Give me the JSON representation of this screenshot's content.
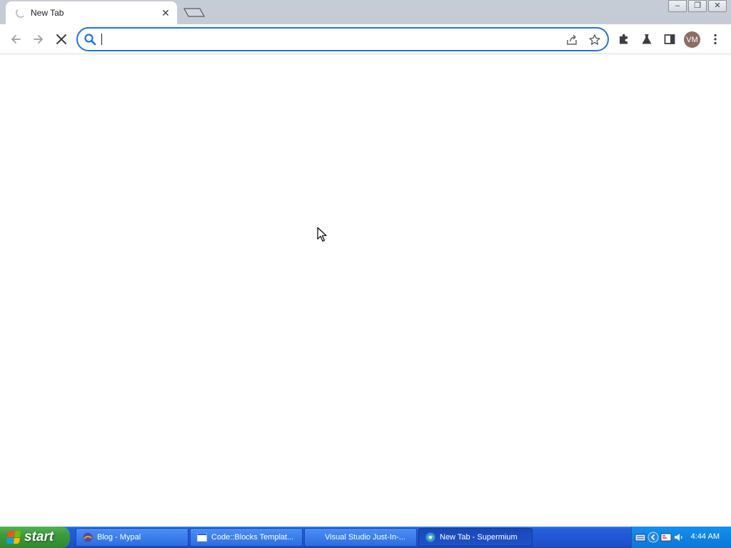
{
  "browser": {
    "tab": {
      "title": "New Tab",
      "close_glyph": "✕"
    },
    "window_controls": {
      "minimize": "–",
      "restore": "❐",
      "close": "✕"
    },
    "omnibox": {
      "value": "",
      "placeholder": ""
    },
    "profile_initials": "VM",
    "accent_color": "#1a73e8"
  },
  "taskbar": {
    "start_label": "start",
    "tasks": [
      {
        "label": "Blog - Mypal",
        "icon": "mypal-icon"
      },
      {
        "label": "Code::Blocks Templat...",
        "icon": "window-icon"
      },
      {
        "label": "Visual Studio Just-In-...",
        "icon": "none"
      },
      {
        "label": "New Tab - Supermium",
        "icon": "supermium-icon"
      }
    ],
    "clock": "4:44 AM"
  }
}
